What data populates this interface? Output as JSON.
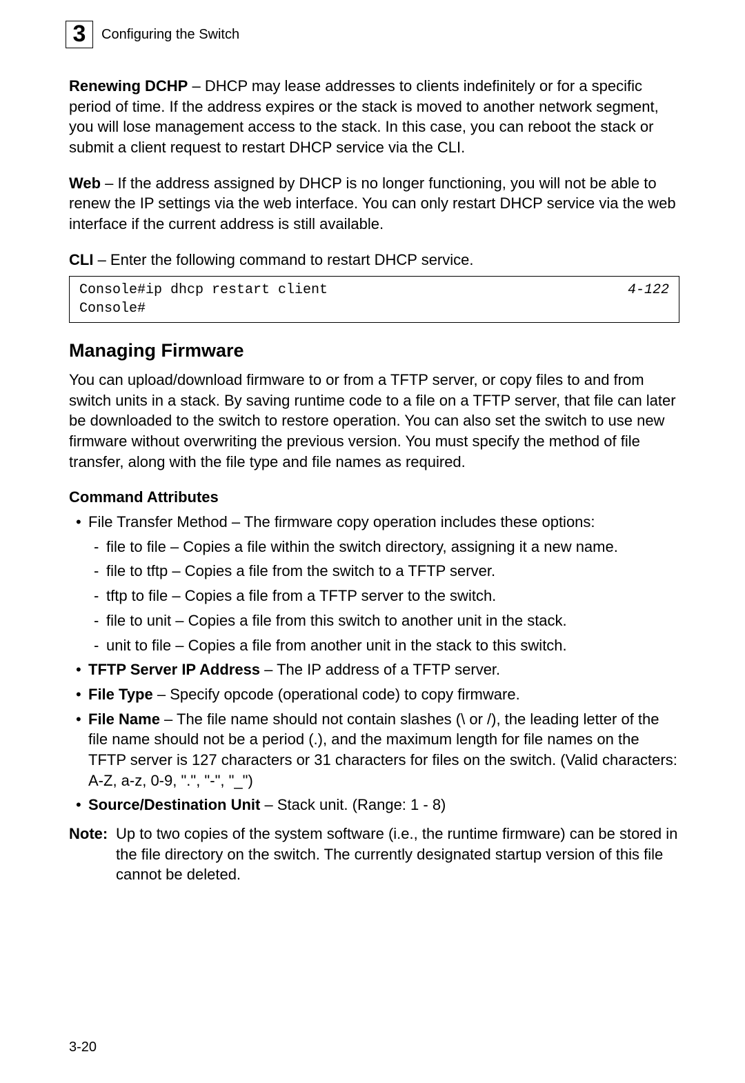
{
  "header": {
    "chapter_number": "3",
    "chapter_title": "Configuring the Switch"
  },
  "paragraphs": {
    "renewing_label": "Renewing DCHP",
    "renewing_text": " – DHCP may lease addresses to clients indefinitely or for a specific period of time. If the address expires or the stack is moved to another network segment, you will lose management access to the stack. In this case, you can reboot the stack or submit a client request to restart DHCP service via the CLI.",
    "web_label": "Web",
    "web_text": " – If the address assigned by DHCP is no longer functioning, you will not be able to renew the IP settings via the web interface. You can only restart DHCP service via the web interface if the current address is still available.",
    "cli_label": "CLI",
    "cli_text": " – Enter the following command to restart DHCP service."
  },
  "cli_box": {
    "lines": "Console#ip dhcp restart client\nConsole#",
    "reference": "4-122"
  },
  "section": {
    "heading": "Managing Firmware",
    "intro": "You can upload/download firmware to or from a TFTP server, or copy files to and from switch units in a stack. By saving runtime code to a file on a TFTP server, that file can later be downloaded to the switch to restore operation. You can also set the switch to use new firmware without overwriting the previous version. You must specify the method of file transfer, along with the file type and file names as required."
  },
  "command_attributes": {
    "heading": "Command Attributes",
    "bullets": {
      "ftm_text": "File Transfer Method – The firmware copy operation includes these options:",
      "ftm_sub": [
        "file to file – Copies a file within the switch directory, assigning it a new name.",
        "file to tftp – Copies a file from the switch to a TFTP server.",
        "tftp to file – Copies a file from a TFTP server to the switch.",
        "file to unit – Copies a file from this switch to another unit in the stack.",
        "unit to file – Copies a file from another unit in the stack to this switch."
      ],
      "tftp_label": "TFTP Server IP Address",
      "tftp_text": " – The IP address of a TFTP server.",
      "filetype_label": "File Type",
      "filetype_text": " – Specify opcode (operational code) to copy firmware.",
      "filename_label": "File Name",
      "filename_text": " – The file name should not contain slashes (\\ or /), the leading letter of the file name should not be a period (.), and the maximum length for file names on the TFTP server is 127 characters or 31 characters for files on the switch. (Valid characters: A-Z, a-z, 0-9, \".\", \"-\", \"_\")",
      "sdu_label": "Source/Destination Unit",
      "sdu_text": " – Stack unit. (Range: 1 - 8)"
    }
  },
  "note": {
    "label": "Note:",
    "text": "Up to two copies of the system software (i.e., the runtime firmware) can be stored in the file directory on the switch. The currently designated startup version of this file cannot be deleted."
  },
  "page_number": "3-20"
}
